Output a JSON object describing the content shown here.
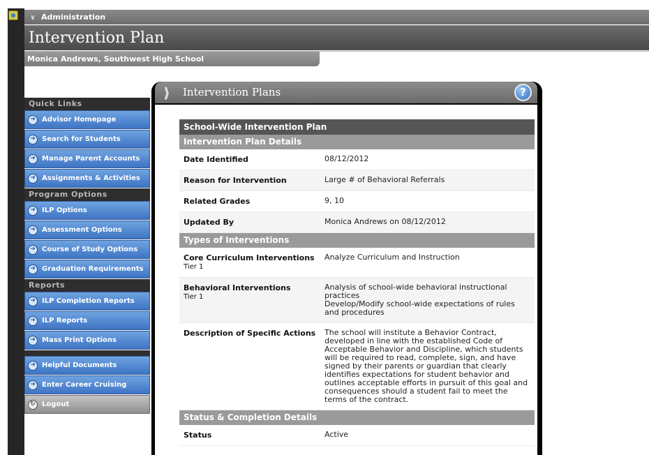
{
  "header": {
    "admin_label": "Administration",
    "title": "Intervention Plan",
    "subtitle": "Monica Andrews, Southwest High School"
  },
  "sidebar": {
    "quick_links_heading": "Quick Links",
    "quick_links": [
      {
        "label": "Advisor Homepage"
      },
      {
        "label": "Search for Students"
      },
      {
        "label": "Manage Parent Accounts"
      },
      {
        "label": "Assignments & Activities"
      }
    ],
    "program_heading": "Program Options",
    "program_options": [
      {
        "label": "ILP Options"
      },
      {
        "label": "Assessment Options"
      },
      {
        "label": "Course of Study Options"
      },
      {
        "label": "Graduation Requirements"
      }
    ],
    "reports_heading": "Reports",
    "reports": [
      {
        "label": "ILP Completion Reports"
      },
      {
        "label": "ILP Reports"
      },
      {
        "label": "Mass Print Options"
      }
    ],
    "extra": [
      {
        "label": "Helpful Documents"
      },
      {
        "label": "Enter Career Cruising"
      }
    ],
    "logout": "Logout"
  },
  "panel": {
    "title": "Intervention Plans",
    "help": "?"
  },
  "plan": {
    "title": "School-Wide Intervention Plan",
    "details_heading": "Intervention Plan Details",
    "date_label": "Date Identified",
    "date_value": "08/12/2012",
    "reason_label": "Reason for Intervention",
    "reason_value": "Large # of Behavioral Referrals",
    "grades_label": "Related Grades",
    "grades_value": "9, 10",
    "updated_label": "Updated By",
    "updated_value": "Monica Andrews on 08/12/2012",
    "types_heading": "Types of Interventions",
    "core_label": "Core Curriculum Interventions",
    "core_tier": "Tier 1",
    "core_value": "Analyze Curriculum and Instruction",
    "behav_label": "Behavioral Interventions",
    "behav_tier": "Tier 1",
    "behav_value_1": "Analysis of school-wide behavioral instructional practices",
    "behav_value_2": "Develop/Modify school-wide expectations of rules and procedures",
    "desc_label": "Description of Specific Actions",
    "desc_value": "The school will institute a Behavior Contract, developed in line with the established Code of Acceptable Behavior and Discipline, which students will be required to read, complete, sign, and have signed by their parents or guardian that clearly identifies expectations for student behavior and outlines acceptable efforts in pursuit of this goal and consequences should a student fail to meet the terms of the contract.",
    "status_heading": "Status & Completion Details",
    "status_label": "Status",
    "status_value": "Active"
  }
}
